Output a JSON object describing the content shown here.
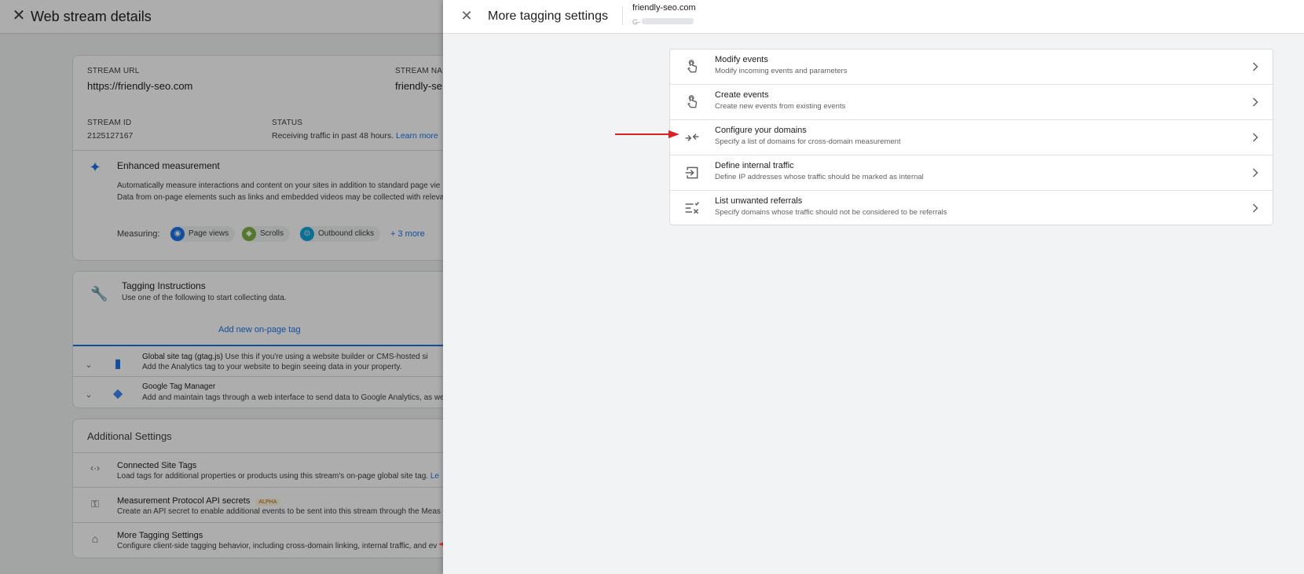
{
  "background": {
    "title": "Web stream details",
    "stream_url_label": "STREAM URL",
    "stream_url": "https://friendly-seo.com",
    "stream_name_label": "STREAM NAME",
    "stream_name": "friendly-se",
    "stream_id_label": "STREAM ID",
    "stream_id": "2125127167",
    "status_label": "STATUS",
    "status_text": "Receiving traffic in past 48 hours.",
    "status_link": "Learn more",
    "enhanced_title": "Enhanced measurement",
    "enhanced_desc1": "Automatically measure interactions and content on your sites in addition to standard page vie",
    "enhanced_desc2": "Data from on-page elements such as links and embedded videos may be collected with relevan",
    "measuring_label": "Measuring:",
    "chips": [
      {
        "label": "Page views",
        "color": "#1a73e8"
      },
      {
        "label": "Scrolls",
        "color": "#7cb342"
      },
      {
        "label": "Outbound clicks",
        "color": "#12a4d9"
      }
    ],
    "more_link": "+ 3 more",
    "tagging_title": "Tagging Instructions",
    "tagging_desc": "Use one of the following to start collecting data.",
    "add_tag_link": "Add new on-page tag",
    "gtag_title": "Global site tag (gtag.js)",
    "gtag_title_rest": "Use this if you're using a website builder or CMS-hosted si",
    "gtag_desc": "Add the Analytics tag to your website to begin seeing data in your property.",
    "gtm_title": "Google Tag Manager",
    "gtm_desc": "Add and maintain tags through a web interface to send data to Google Analytics, as we",
    "additional_title": "Additional Settings",
    "connected_title": "Connected Site Tags",
    "connected_desc": "Load tags for additional properties or products using this stream's on-page global site tag.",
    "connected_link": "Le",
    "mp_title": "Measurement Protocol API secrets",
    "mp_badge": "ALPHA",
    "mp_desc": "Create an API secret to enable additional events to be sent into this stream through the Meas",
    "more_tagging_title": "More Tagging Settings",
    "more_tagging_desc": "Configure client-side tagging behavior, including cross-domain linking, internal traffic, and ev"
  },
  "drawer": {
    "title": "More tagging settings",
    "site": "friendly-seo.com",
    "id_prefix": "G-",
    "items": [
      {
        "title": "Modify events",
        "desc": "Modify incoming events and parameters",
        "icon": "touch-icon"
      },
      {
        "title": "Create events",
        "desc": "Create new events from existing events",
        "icon": "touch-icon"
      },
      {
        "title": "Configure your domains",
        "desc": "Specify a list of domains for cross-domain measurement",
        "icon": "merge-arrows-icon"
      },
      {
        "title": "Define internal traffic",
        "desc": "Define IP addresses whose traffic should be marked as internal",
        "icon": "login-icon"
      },
      {
        "title": "List unwanted referrals",
        "desc": "Specify domains whose traffic should not be considered to be referrals",
        "icon": "list-remove-icon"
      }
    ]
  },
  "colors": {
    "accent": "#1a73e8",
    "arrow": "#e02020"
  }
}
